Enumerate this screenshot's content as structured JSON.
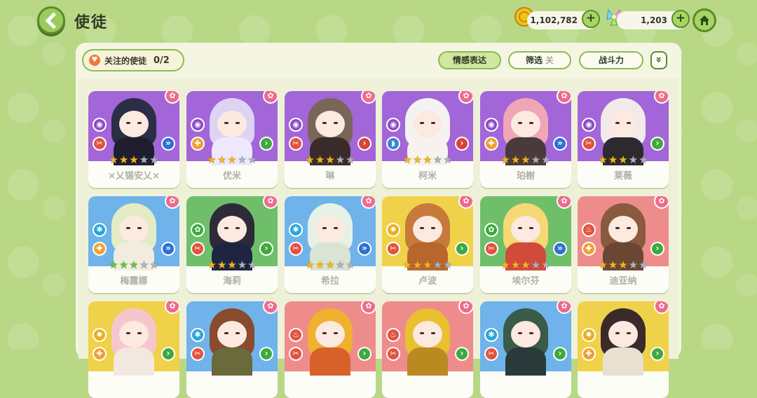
{
  "header": {
    "title": "使徒",
    "gold": "1,102,782",
    "gems": "1,203"
  },
  "toolbar": {
    "favorites_label": "关注的使徒",
    "favorites_count": "0/2",
    "emotion_label": "情感表达",
    "filter_label": "筛选",
    "filter_state": "关",
    "power_label": "战斗力",
    "expand_glyph": "»"
  },
  "cards": [
    {
      "name": "×乂锡安乂×",
      "stars": 3,
      "bg": "#a266d8",
      "hair": "#2b2e45",
      "body": "#1e1e2e",
      "elem": "#8a4ac9",
      "elem_glyph": "◉",
      "role": "#e2533f",
      "role_glyph": "✂",
      "atk": "#2f6fd6",
      "atk_glyph": "»"
    },
    {
      "name": "优米",
      "stars": 3,
      "bg": "#a266d8",
      "hair": "#dcd4f2",
      "body": "#efe9ff",
      "elem": "#8a4ac9",
      "elem_glyph": "◉",
      "role": "#f0a033",
      "role_glyph": "✚",
      "atk": "#3ea93e",
      "atk_glyph": "›"
    },
    {
      "name": "琳",
      "stars": 3,
      "bg": "#a266d8",
      "hair": "#7a6659",
      "body": "#3a2b2b",
      "elem": "#8a4ac9",
      "elem_glyph": "◉",
      "role": "#e2533f",
      "role_glyph": "✂",
      "atk": "#d9433a",
      "atk_glyph": "›"
    },
    {
      "name": "柯米",
      "stars": 3,
      "bg": "#a266d8",
      "hair": "#f4f2f2",
      "body": "#f7f2ee",
      "elem": "#8a4ac9",
      "elem_glyph": "◉",
      "role": "#3a82d8",
      "role_glyph": "◗",
      "atk": "#d9433a",
      "atk_glyph": "›"
    },
    {
      "name": "珀榭",
      "stars": 3,
      "bg": "#a266d8",
      "hair": "#f0a6b6",
      "body": "#4a3a3a",
      "elem": "#8a4ac9",
      "elem_glyph": "◉",
      "role": "#f0a033",
      "role_glyph": "✚",
      "atk": "#2f6fd6",
      "atk_glyph": "»"
    },
    {
      "name": "莱薇",
      "stars": 3,
      "bg": "#a266d8",
      "hair": "#f1e9ea",
      "body": "#2c2a2e",
      "elem": "#8a4ac9",
      "elem_glyph": "◉",
      "role": "#e2533f",
      "role_glyph": "✂",
      "atk": "#3ea93e",
      "atk_glyph": "›"
    },
    {
      "name": "梅露娜",
      "stars": 3,
      "bg": "#6fb3ea",
      "hair": "#e3ecc4",
      "body": "#f0ece0",
      "elem": "#2aa6d8",
      "elem_glyph": "✱",
      "role": "#f0a033",
      "role_glyph": "✚",
      "atk": "#2f6fd6",
      "atk_glyph": "»"
    },
    {
      "name": "海莉",
      "stars": 3,
      "bg": "#6fbf6a",
      "hair": "#2e2a3a",
      "body": "#1f2540",
      "elem": "#3ea93e",
      "elem_glyph": "✿",
      "role": "#e2533f",
      "role_glyph": "✂",
      "atk": "#3ea93e",
      "atk_glyph": "›"
    },
    {
      "name": "希拉",
      "stars": 3,
      "bg": "#6fb3ea",
      "hair": "#e8f1e6",
      "body": "#d9e4d2",
      "elem": "#2aa6d8",
      "elem_glyph": "✱",
      "role": "#e2533f",
      "role_glyph": "✂",
      "atk": "#2f6fd6",
      "atk_glyph": "»"
    },
    {
      "name": "卢波",
      "stars": 3,
      "bg": "#f0d24a",
      "hair": "#c77a3a",
      "body": "#b8662e",
      "elem": "#e8b020",
      "elem_glyph": "✹",
      "role": "#e2533f",
      "role_glyph": "✂",
      "atk": "#3ea93e",
      "atk_glyph": "›"
    },
    {
      "name": "埃尔芬",
      "stars": 3,
      "bg": "#6fbf6a",
      "hair": "#f6d874",
      "body": "#d24a3a",
      "elem": "#3ea93e",
      "elem_glyph": "✿",
      "role": "#e2533f",
      "role_glyph": "✂",
      "atk": "#2f6fd6",
      "atk_glyph": "»"
    },
    {
      "name": "迪亚纳",
      "stars": 3,
      "bg": "#ee8c8c",
      "hair": "#8a5a3e",
      "body": "#6a4634",
      "elem": "#e2533f",
      "elem_glyph": "♨",
      "role": "#f0a033",
      "role_glyph": "✚",
      "atk": "#3ea93e",
      "atk_glyph": "›"
    },
    {
      "name": "",
      "stars": 0,
      "bg": "#f0d24a",
      "hair": "#f6c6cf",
      "body": "#f2e8e0",
      "elem": "#e8b020",
      "elem_glyph": "✹",
      "role": "#f0a033",
      "role_glyph": "✚",
      "atk": "#3ea93e",
      "atk_glyph": "›"
    },
    {
      "name": "",
      "stars": 0,
      "bg": "#6fb3ea",
      "hair": "#8a4a2e",
      "body": "#6a6a3a",
      "elem": "#2aa6d8",
      "elem_glyph": "✱",
      "role": "#e2533f",
      "role_glyph": "✂",
      "atk": "#3ea93e",
      "atk_glyph": "›"
    },
    {
      "name": "",
      "stars": 0,
      "bg": "#ee8c8c",
      "hair": "#f0b030",
      "body": "#d8602a",
      "elem": "#e2533f",
      "elem_glyph": "♨",
      "role": "#e2533f",
      "role_glyph": "✂",
      "atk": "#3ea93e",
      "atk_glyph": "›"
    },
    {
      "name": "",
      "stars": 0,
      "bg": "#ee8c8c",
      "hair": "#e8c030",
      "body": "#b88a20",
      "elem": "#e2533f",
      "elem_glyph": "♨",
      "role": "#e2533f",
      "role_glyph": "✂",
      "atk": "#3ea93e",
      "atk_glyph": "›"
    },
    {
      "name": "",
      "stars": 0,
      "bg": "#6fb3ea",
      "hair": "#3a5a4a",
      "body": "#2a3a3a",
      "elem": "#2aa6d8",
      "elem_glyph": "✱",
      "role": "#e2533f",
      "role_glyph": "✂",
      "atk": "#3ea93e",
      "atk_glyph": "›"
    },
    {
      "name": "",
      "stars": 0,
      "bg": "#f0d24a",
      "hair": "#3a2a2a",
      "body": "#e8e0d0",
      "elem": "#e8b020",
      "elem_glyph": "✹",
      "role": "#f0a033",
      "role_glyph": "✚",
      "atk": "#3ea93e",
      "atk_glyph": "›"
    }
  ],
  "star_max": 5
}
